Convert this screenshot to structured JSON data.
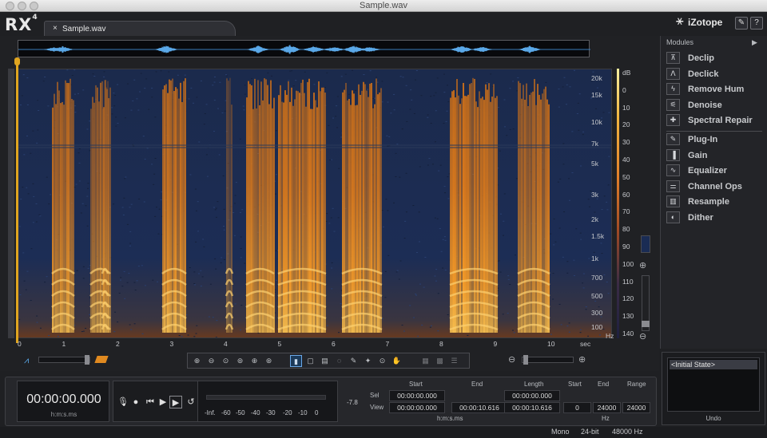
{
  "window": {
    "title": "Sample.wav"
  },
  "app": {
    "logo": "RX",
    "logo_sup": "4",
    "brand": "iZotope"
  },
  "tab": {
    "close": "×",
    "label": "Sample.wav"
  },
  "toolbar_icons": {
    "settings": "wrench-icon",
    "help": "?"
  },
  "freq_labels": [
    "20k",
    "15k",
    "10k",
    "7k",
    "5k",
    "3k",
    "2k",
    "1.5k",
    "1k",
    "700",
    "500",
    "300",
    "100"
  ],
  "freq_unit": "Hz",
  "db_labels": [
    "dB",
    "0",
    "10",
    "20",
    "30",
    "40",
    "50",
    "60",
    "70",
    "80",
    "90",
    "100",
    "110",
    "120",
    "130",
    "140"
  ],
  "time_labels": [
    "0",
    "1",
    "2",
    "3",
    "4",
    "5",
    "6",
    "7",
    "8",
    "9",
    "10",
    "sec"
  ],
  "modules": {
    "header": "Modules",
    "items": [
      {
        "label": "Declip",
        "icon": "declip-icon"
      },
      {
        "label": "Declick",
        "icon": "declick-icon"
      },
      {
        "label": "Remove Hum",
        "icon": "hum-icon"
      },
      {
        "label": "Denoise",
        "icon": "denoise-icon"
      },
      {
        "label": "Spectral Repair",
        "icon": "spectral-repair-icon"
      },
      {
        "label": "Plug-In",
        "icon": "plugin-icon"
      },
      {
        "label": "Gain",
        "icon": "gain-icon"
      },
      {
        "label": "Equalizer",
        "icon": "equalizer-icon"
      },
      {
        "label": "Channel Ops",
        "icon": "channel-ops-icon"
      },
      {
        "label": "Resample",
        "icon": "resample-icon"
      },
      {
        "label": "Dither",
        "icon": "dither-icon"
      }
    ]
  },
  "transport": {
    "time": "00:00:00.000",
    "time_unit": "h:m:s.ms",
    "meter_peak": "-7.8",
    "meter_labels": [
      "-Inf.",
      "-60",
      "-50",
      "-40",
      "-30",
      "-20",
      "-10",
      "0"
    ]
  },
  "selview": {
    "headers": [
      "Start",
      "End",
      "Length"
    ],
    "row_labels": [
      "Sel",
      "View"
    ],
    "sel": [
      "00:00:00.000",
      "",
      "00:00:00.000"
    ],
    "view": [
      "00:00:00.000",
      "00:00:10.616",
      "00:00:10.616"
    ],
    "unit": "h:m:s.ms"
  },
  "range": {
    "headers": [
      "Start",
      "End",
      "Range"
    ],
    "values": [
      "0",
      "24000",
      "24000"
    ],
    "unit": "Hz"
  },
  "undo": {
    "item": "<Initial State>",
    "label": "Undo"
  },
  "status": {
    "channels": "Mono",
    "bitdepth": "24-bit",
    "samplerate": "48000 Hz"
  },
  "colors": {
    "accent": "#e0a520",
    "waveform": "#5aa8e8",
    "spectrogram_bg": "#1a2c54",
    "spectrogram_hot": "#f08a1e"
  }
}
